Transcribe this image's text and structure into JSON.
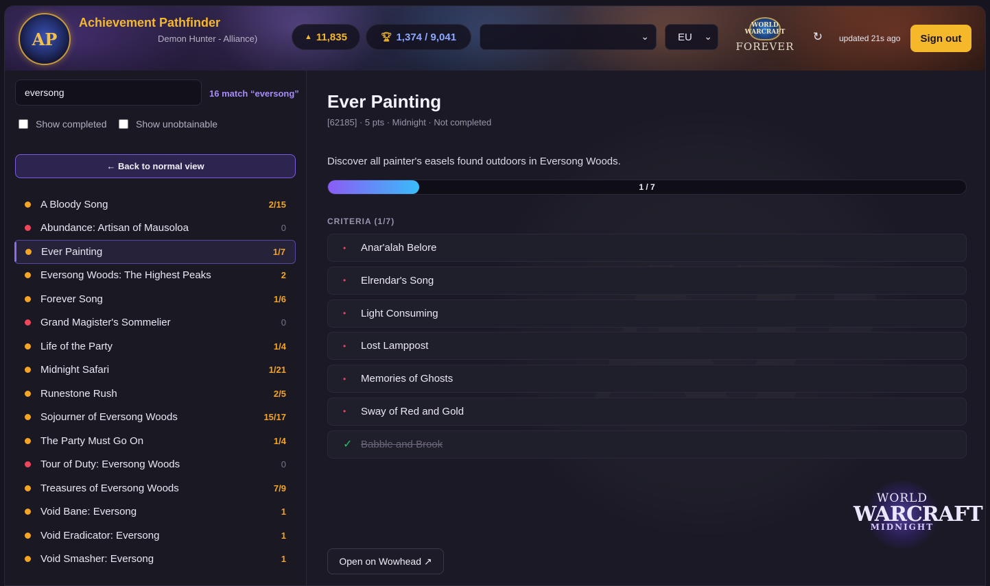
{
  "header": {
    "logo_text": "AP",
    "app_title": "Achievement Pathfinder",
    "character_subtitle": "Demon Hunter - Alliance)",
    "points": "11,835",
    "achievements_count": "1,374 / 9,041",
    "character_select_value": "",
    "region": "EU",
    "wow_forever_crest": "WORLD WARCRAFT",
    "wow_forever_text": "FOREVER",
    "refresh_icon": "↻",
    "updated": "updated 21s ago",
    "sign_out": "Sign out"
  },
  "sidebar": {
    "search_value": "eversong",
    "match_text": "16 match “eversong”",
    "filters": {
      "show_completed": "Show completed",
      "show_unobtainable": "Show unobtainable"
    },
    "back_button": "← Back to normal view",
    "items": [
      {
        "name": "A Bloody Song",
        "progress": "2/15",
        "status": "in-progress"
      },
      {
        "name": "Abundance: Artisan of Mausoloa",
        "progress": "0",
        "status": "not-started"
      },
      {
        "name": "Ever Painting",
        "progress": "1/7",
        "status": "in-progress"
      },
      {
        "name": "Eversong Woods: The Highest Peaks",
        "progress": "2",
        "status": "in-progress"
      },
      {
        "name": "Forever Song",
        "progress": "1/6",
        "status": "in-progress"
      },
      {
        "name": "Grand Magister's Sommelier",
        "progress": "0",
        "status": "not-started"
      },
      {
        "name": "Life of the Party",
        "progress": "1/4",
        "status": "in-progress"
      },
      {
        "name": "Midnight Safari",
        "progress": "1/21",
        "status": "in-progress"
      },
      {
        "name": "Runestone Rush",
        "progress": "2/5",
        "status": "in-progress"
      },
      {
        "name": "Sojourner of Eversong Woods",
        "progress": "15/17",
        "status": "in-progress"
      },
      {
        "name": "The Party Must Go On",
        "progress": "1/4",
        "status": "in-progress"
      },
      {
        "name": "Tour of Duty: Eversong Woods",
        "progress": "0",
        "status": "not-started"
      },
      {
        "name": "Treasures of Eversong Woods",
        "progress": "7/9",
        "status": "in-progress"
      },
      {
        "name": "Void Bane: Eversong",
        "progress": "1",
        "status": "in-progress"
      },
      {
        "name": "Void Eradicator: Eversong",
        "progress": "1",
        "status": "in-progress"
      },
      {
        "name": "Void Smasher: Eversong",
        "progress": "1",
        "status": "in-progress"
      }
    ]
  },
  "detail": {
    "title": "Ever Painting",
    "meta": "[62185] · 5 pts · Midnight · Not completed",
    "description": "Discover all painter's easels found outdoors in Eversong Woods.",
    "progress_label": "1 / 7",
    "progress_fraction": 0.142857,
    "criteria_heading": "CRITERIA (1/7)",
    "criteria": [
      {
        "label": "Anar'alah Belore",
        "done": false
      },
      {
        "label": "Elrendar's Song",
        "done": false
      },
      {
        "label": "Light Consuming",
        "done": false
      },
      {
        "label": "Lost Lamppost",
        "done": false
      },
      {
        "label": "Memories of Ghosts",
        "done": false
      },
      {
        "label": "Sway of Red and Gold",
        "done": false
      },
      {
        "label": "Babble and Brook",
        "done": true
      }
    ],
    "wowhead_button": "Open on Wowhead ↗",
    "expansion_logo": {
      "line1": "WORLD",
      "line2": "WARCRAFT",
      "line3": "MIDNIGHT"
    }
  },
  "colors": {
    "accent_gold": "#f5b82a",
    "accent_purple": "#8b5cf6",
    "in_progress": "#f5a524",
    "not_started": "#f0465a",
    "completed": "#22c55e"
  },
  "icons": {
    "points": "triangle-up-icon",
    "achievements": "trophy-icon",
    "dropdown": "chevron-down-icon",
    "refresh": "refresh-icon",
    "criteria_pending": "bullet-icon",
    "criteria_done": "checkmark-icon",
    "external_link": "external-link-icon"
  }
}
